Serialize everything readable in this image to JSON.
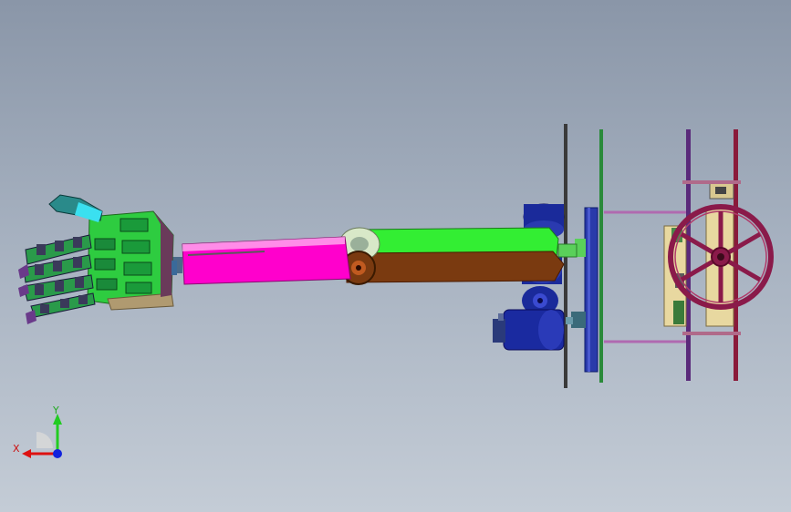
{
  "viewport": {
    "background_top": "#8a96a8",
    "background_bottom": "#c4ccd6",
    "model_parts": [
      "robotic-hand",
      "forearm-link",
      "upper-arm-belt-drive",
      "shoulder-motor-stack",
      "base-plates",
      "base-gear",
      "base-frame",
      "handwheel"
    ],
    "colors": {
      "hand_body": "#2ecc40",
      "hand_dark": "#3a3a5a",
      "forearm": "#ff00cc",
      "link_green": "#33ee33",
      "link_brown": "#7a3a10",
      "motor_blue": "#1a2a9a",
      "plate_dark": "#3a3a3a",
      "plate_green": "#2a8a3a",
      "frame_maroon": "#8a1a3a",
      "frame_purple": "#5a2a7a",
      "handwheel": "#8a1a4a",
      "frame_wood": "#e8d8a0",
      "gear_blue": "#2a3aaa"
    }
  },
  "triad": {
    "x_label": "X",
    "y_label": "Y",
    "x_color": "#dd1111",
    "y_color": "#22cc22",
    "z_color": "#1122dd"
  }
}
